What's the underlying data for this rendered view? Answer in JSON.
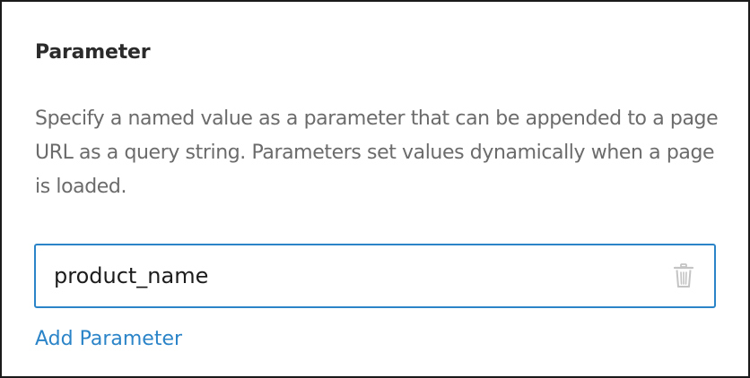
{
  "panel": {
    "title": "Parameter",
    "description": "Specify a named value as a parameter that can be appended to a page URL as a query string. Parameters set values dynamically when a page is loaded.",
    "parameter": {
      "value": "product_name",
      "delete_icon": "trash-icon"
    },
    "add_link_label": "Add Parameter"
  },
  "colors": {
    "accent": "#2a84c7",
    "title": "#2b2b2b",
    "description": "#6b6b6b",
    "icon": "#c4c4c4",
    "border": "#1a1a1a"
  }
}
